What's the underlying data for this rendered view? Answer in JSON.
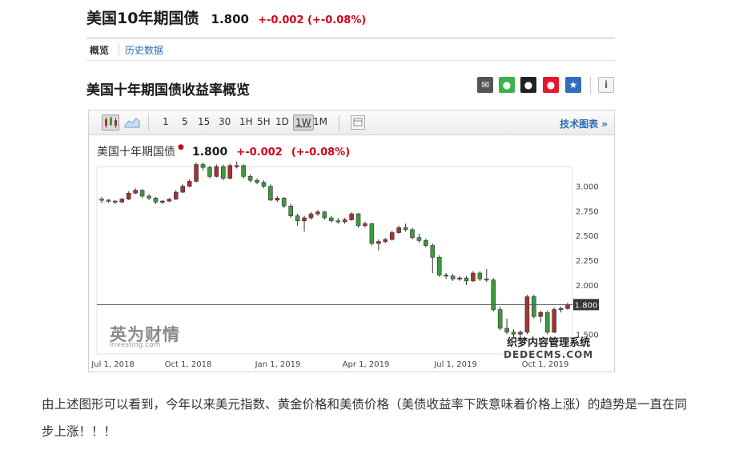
{
  "header": {
    "title": "美国10年期国债",
    "price": "1.800",
    "change": "+-0.002 (+-0.08%)"
  },
  "tabs": {
    "active": "概览",
    "link": "历史数据"
  },
  "section": {
    "title": "美国十年期国债收益率概览"
  },
  "share_icons": [
    {
      "icon": "mail-icon",
      "glyph": "✉",
      "color": "#555555"
    },
    {
      "icon": "wechat-icon",
      "glyph": "●",
      "color": "#3bb34a"
    },
    {
      "icon": "qq-icon",
      "glyph": "●",
      "color": "#222222"
    },
    {
      "icon": "weibo-icon",
      "glyph": "●",
      "color": "#e6162d"
    },
    {
      "icon": "favorite-icon",
      "glyph": "★",
      "color": "#2f6fbf"
    },
    {
      "icon": "info-icon",
      "glyph": "i",
      "color": "#666666"
    }
  ],
  "toolbar": {
    "intervals": [
      "1",
      "5",
      "15",
      "30",
      "1H",
      "5H",
      "1D",
      "1W",
      "1M"
    ],
    "selected_interval": "1W",
    "tech_link": "技术图表 »"
  },
  "legend": {
    "name": "美国十年期国债",
    "price": "1.800",
    "change": "+-0.002",
    "change_pct": "(+-0.08%)"
  },
  "watermark": {
    "logo": "英为财情",
    "logo_sub": "Investing.com",
    "site_cn": "织梦内容管理系统",
    "site_en": "DEDECMS.COM"
  },
  "chart_data": {
    "type": "candlestick",
    "x_tick_labels": [
      "Jul 1, 2018",
      "Oct 1, 2018",
      "Jan 1, 2019",
      "Apr 1, 2019",
      "Jul 1, 2019",
      "Oct 1, 2019"
    ],
    "y_ticks": [
      "3.000",
      "2.750",
      "2.500",
      "2.250",
      "2.000",
      "1.500"
    ],
    "ylim": [
      1.3,
      3.2
    ],
    "current_value": 1.8,
    "current_label": "1.800",
    "colors": {
      "up": "#a83232",
      "down": "#3d9a3d",
      "line": "#555555"
    },
    "candles": [
      [
        2.87,
        2.86,
        2.89,
        2.83
      ],
      [
        2.86,
        2.85,
        2.87,
        2.83
      ],
      [
        2.85,
        2.84,
        2.86,
        2.82
      ],
      [
        2.84,
        2.87,
        2.88,
        2.83
      ],
      [
        2.87,
        2.93,
        2.95,
        2.86
      ],
      [
        2.93,
        2.96,
        2.98,
        2.92
      ],
      [
        2.96,
        2.9,
        2.97,
        2.88
      ],
      [
        2.9,
        2.88,
        2.92,
        2.86
      ],
      [
        2.88,
        2.84,
        2.89,
        2.82
      ],
      [
        2.84,
        2.85,
        2.86,
        2.82
      ],
      [
        2.85,
        2.87,
        2.88,
        2.84
      ],
      [
        2.87,
        2.94,
        2.96,
        2.86
      ],
      [
        2.94,
        3.0,
        3.02,
        2.93
      ],
      [
        3.0,
        3.05,
        3.07,
        2.99
      ],
      [
        3.05,
        3.22,
        3.24,
        3.04
      ],
      [
        3.22,
        3.19,
        3.24,
        3.16
      ],
      [
        3.19,
        3.1,
        3.21,
        3.08
      ],
      [
        3.1,
        3.2,
        3.22,
        3.09
      ],
      [
        3.2,
        3.08,
        3.22,
        3.06
      ],
      [
        3.08,
        3.21,
        3.23,
        3.07
      ],
      [
        3.21,
        3.21,
        3.25,
        3.18
      ],
      [
        3.21,
        3.1,
        3.22,
        3.08
      ],
      [
        3.1,
        3.06,
        3.12,
        3.04
      ],
      [
        3.06,
        3.04,
        3.08,
        3.02
      ],
      [
        3.04,
        3.0,
        3.06,
        2.98
      ],
      [
        3.0,
        2.86,
        3.02,
        2.85
      ],
      [
        2.86,
        2.88,
        2.9,
        2.84
      ],
      [
        2.88,
        2.8,
        2.89,
        2.78
      ],
      [
        2.8,
        2.7,
        2.82,
        2.68
      ],
      [
        2.7,
        2.65,
        2.72,
        2.6
      ],
      [
        2.65,
        2.68,
        2.7,
        2.54
      ],
      [
        2.68,
        2.72,
        2.74,
        2.66
      ],
      [
        2.72,
        2.74,
        2.76,
        2.7
      ],
      [
        2.74,
        2.68,
        2.75,
        2.66
      ],
      [
        2.68,
        2.65,
        2.7,
        2.63
      ],
      [
        2.65,
        2.64,
        2.68,
        2.62
      ],
      [
        2.64,
        2.66,
        2.68,
        2.62
      ],
      [
        2.66,
        2.72,
        2.74,
        2.65
      ],
      [
        2.72,
        2.6,
        2.73,
        2.58
      ],
      [
        2.6,
        2.62,
        2.64,
        2.58
      ],
      [
        2.62,
        2.42,
        2.63,
        2.4
      ],
      [
        2.42,
        2.44,
        2.46,
        2.35
      ],
      [
        2.44,
        2.46,
        2.48,
        2.42
      ],
      [
        2.46,
        2.53,
        2.55,
        2.45
      ],
      [
        2.53,
        2.58,
        2.6,
        2.52
      ],
      [
        2.58,
        2.56,
        2.62,
        2.54
      ],
      [
        2.56,
        2.48,
        2.58,
        2.46
      ],
      [
        2.48,
        2.45,
        2.52,
        2.43
      ],
      [
        2.45,
        2.4,
        2.47,
        2.38
      ],
      [
        2.4,
        2.28,
        2.42,
        2.12
      ],
      [
        2.28,
        2.1,
        2.3,
        2.08
      ],
      [
        2.1,
        2.09,
        2.12,
        2.06
      ],
      [
        2.09,
        2.06,
        2.11,
        2.04
      ],
      [
        2.06,
        2.07,
        2.09,
        2.04
      ],
      [
        2.07,
        2.04,
        2.09,
        2.0
      ],
      [
        2.04,
        2.12,
        2.14,
        2.03
      ],
      [
        2.12,
        2.06,
        2.14,
        2.04
      ],
      [
        2.06,
        2.05,
        2.16,
        2.03
      ],
      [
        2.05,
        1.75,
        2.07,
        1.73
      ],
      [
        1.75,
        1.56,
        1.78,
        1.54
      ],
      [
        1.56,
        1.52,
        1.66,
        1.5
      ],
      [
        1.52,
        1.5,
        1.55,
        1.47
      ],
      [
        1.5,
        1.52,
        1.54,
        1.46
      ],
      [
        1.52,
        1.88,
        1.9,
        1.5
      ],
      [
        1.88,
        1.68,
        1.9,
        1.66
      ],
      [
        1.68,
        1.72,
        1.74,
        1.62
      ],
      [
        1.72,
        1.52,
        1.74,
        1.5
      ],
      [
        1.52,
        1.75,
        1.77,
        1.51
      ],
      [
        1.75,
        1.76,
        1.78,
        1.72
      ],
      [
        1.76,
        1.8,
        1.82,
        1.75
      ]
    ]
  },
  "paragraph": "由上述图形可以看到，今年以来美元指数、黄金价格和美债价格（美债收益率下跌意味着价格上涨）的趋势是一直在同步上涨！！！"
}
